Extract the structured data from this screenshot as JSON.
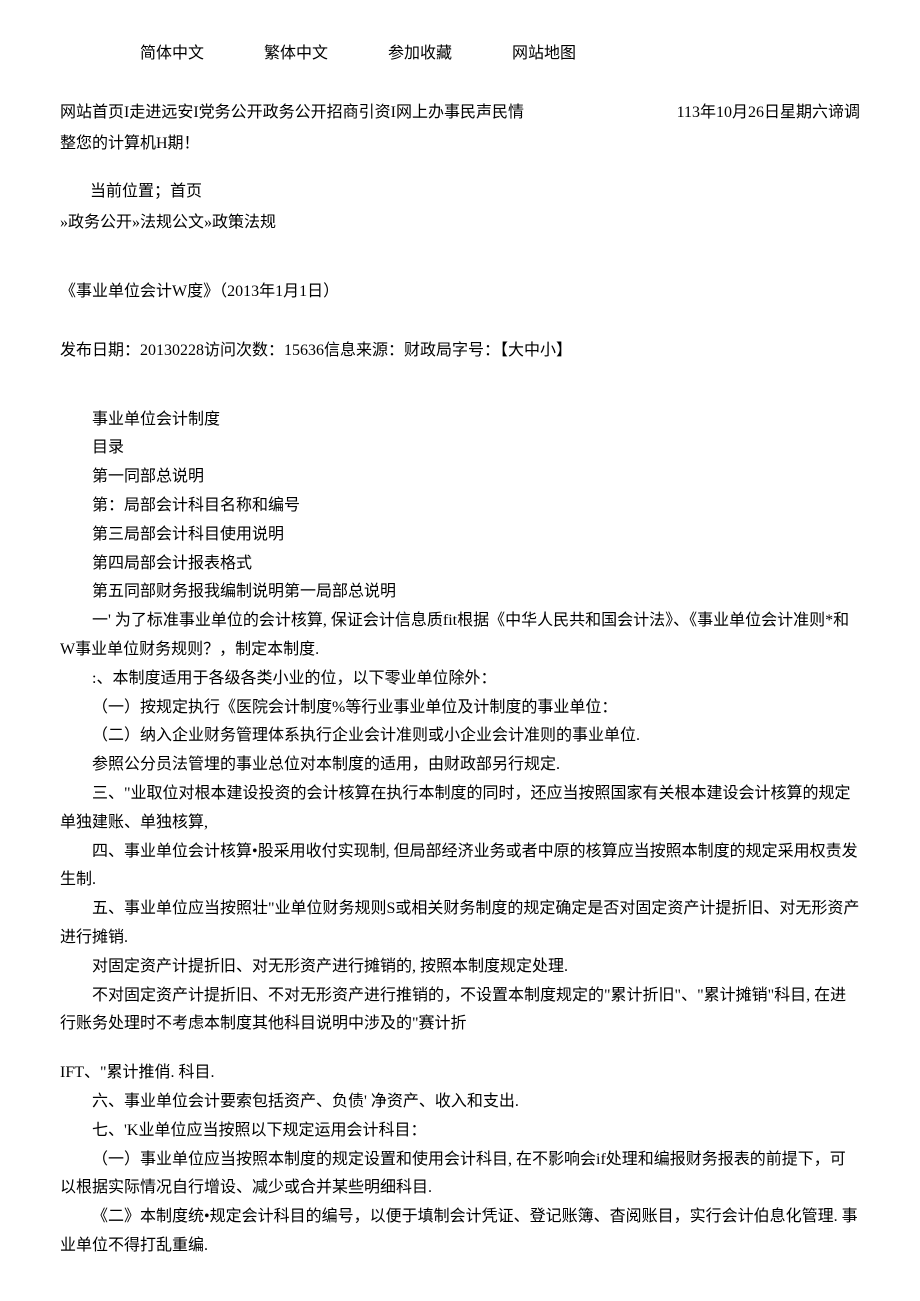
{
  "topNav": {
    "item1": "简体中文",
    "item2": "繁体中文",
    "item3": "参加收藏",
    "item4": "网站地图"
  },
  "mainNav": {
    "left": "网站首页I走进远安I党务公开政务公开招商引资I网上办事民声民情",
    "right": "113年10月26日星期六谛调",
    "adjust": "整您的计算机H期！"
  },
  "location": {
    "label": "当前位置；首页",
    "breadcrumb": "»政务公开»法规公文»政策法规"
  },
  "article": {
    "title": "《事业单位会计W度》（2013年1月1日）",
    "meta": "发布日期：20130228访问次数：15636信息来源：财政局字号：【大中小】"
  },
  "body": {
    "p1": "事业单位会计制度",
    "p2": "目录",
    "p3": "第一同部总说明",
    "p4": "第：局部会计科目名称和编号",
    "p5": "第三局部会计科目使用说明",
    "p6": "第四局部会计报表格式",
    "p7": "第五同部财务报我编制说明第一局部总说明",
    "p8": "一' 为了标准事业单位的会计核算, 保证会计信息质fit根据《中华人民共和国会计法》、《事业单位会计准则*和W事业单位财务规则？，制定本制度.",
    "p9": ":、本制度适用于各级各类小业的位，以下零业单位除外：",
    "p10": "（一）按规定执行《医院会计制度%等行业事业单位及计制度的事业单位：",
    "p11": "（二）纳入企业财务管理体系执行企业会计准则或小企业会计准则的事业单位.",
    "p12": "参照公分员法管埋的事业总位对本制度的适用，由财政部另行规定.",
    "p13": "三、\"业取位对根本建设投资的会计核算在执行本制度的同时，还应当按照国家有关根本建设会计核算的规定单独建账、单独核算,",
    "p14": "四、事业单位会计核算•股采用收付实现制, 但局部经济业务或者中原的核算应当按照本制度的规定采用权责发生制.",
    "p15": "五、事业单位应当按照壮\"业单位财务规则S或相关财务制度的规定确定是否对固定资产计提折旧、对无形资产进行摊销.",
    "p16": "对固定资产计提折旧、对无形资产进行摊销的, 按照本制度规定处理.",
    "p17": "不对固定资产计提折旧、不对无形资产进行推销的，不设置本制度规定的\"累计折旧\"、\"累计摊销\"科目, 在进行账务处理时不考虑本制度其他科目说明中涉及的\"赛计折",
    "p18": "IFT、\"累计推俏. 科目.",
    "p19": "六、事业单位会计要索包括资产、负债' 净资产、收入和支出.",
    "p20": "七、'K业单位应当按照以下规定运用会计科目：",
    "p21": "（一）事业单位应当按照本制度的规定设置和使用会计科目, 在不影响会if处理和编报财务报表的前提下，可以根据实际情况自行增设、减少或合并某些明细科目.",
    "p22": "《二》本制度统•规定会计科目的编号，以便于填制会计凭证、登记账簿、杳阅账目，实行会计伯息化管理. 事业单位不得打乱重编."
  }
}
